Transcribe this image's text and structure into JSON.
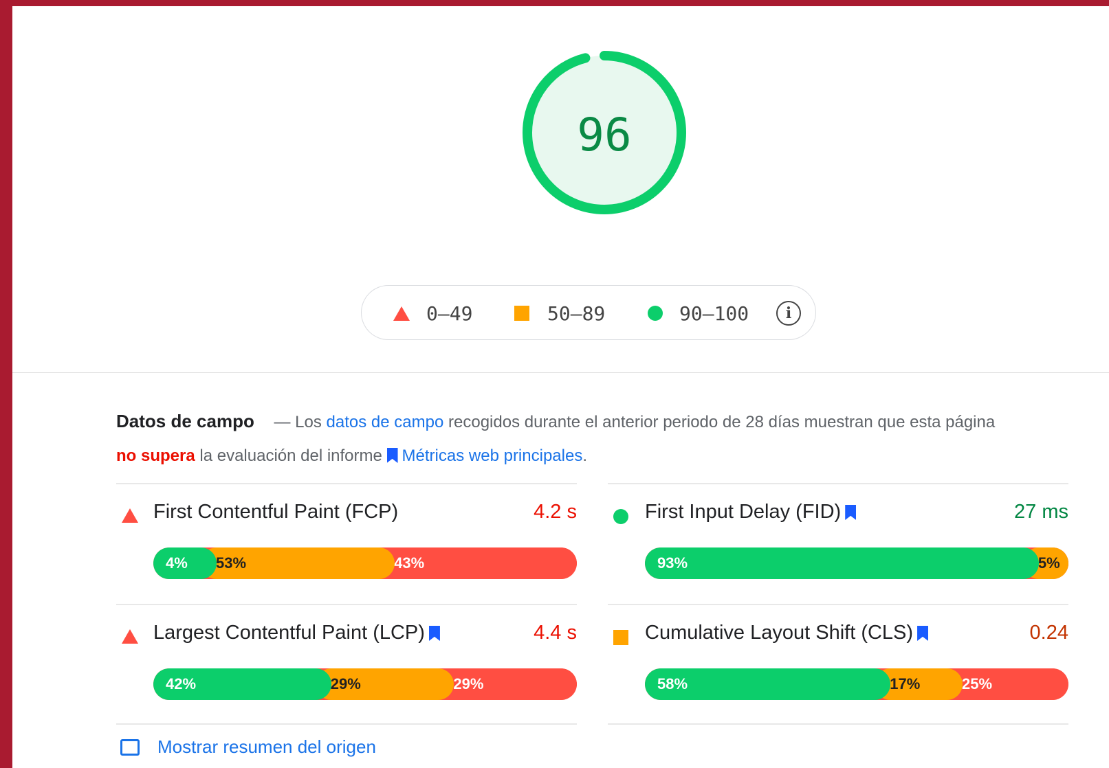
{
  "score": {
    "value": "96",
    "fraction": 0.96,
    "color": "#0cce6b"
  },
  "legend": {
    "fail_range": "0–49",
    "average_range": "50–89",
    "pass_range": "90–100",
    "info_icon": "info-icon"
  },
  "field_data": {
    "title": "Datos de campo",
    "dash": "—",
    "text_before_link": "Los",
    "link_label": "datos de campo",
    "text_after_link": "recogidos durante el anterior periodo de 28 días muestran que esta página",
    "verdict": "no supera",
    "text_after_verdict": "la evaluación del informe",
    "cwv_link": "Métricas web principales",
    "period": "."
  },
  "metrics": [
    {
      "label": "First Contentful Paint (FCP)",
      "value": "4.2 s",
      "status": "fail",
      "core": false,
      "distribution": {
        "good": "4%",
        "average": "53%",
        "poor": "43%"
      },
      "distribution_values": {
        "good": 4,
        "average": 53,
        "poor": 43
      }
    },
    {
      "label": "First Input Delay (FID)",
      "value": "27 ms",
      "status": "pass",
      "core": true,
      "distribution": {
        "good": "93%",
        "average": "5%",
        "poor": "2%"
      },
      "distribution_values": {
        "good": 93,
        "average": 5,
        "poor": 2
      }
    },
    {
      "label": "Largest Contentful Paint (LCP)",
      "value": "4.4 s",
      "status": "fail",
      "core": true,
      "distribution": {
        "good": "42%",
        "average": "29%",
        "poor": "29%"
      },
      "distribution_values": {
        "good": 42,
        "average": 29,
        "poor": 29
      }
    },
    {
      "label": "Cumulative Layout Shift (CLS)",
      "value": "0.24",
      "status": "average",
      "core": true,
      "distribution": {
        "good": "58%",
        "average": "17%",
        "poor": "25%"
      },
      "distribution_values": {
        "good": 58,
        "average": 17,
        "poor": 25
      }
    }
  ],
  "origin_summary_link": "Mostrar resumen del origen",
  "colors": {
    "pass": "#0cce6b",
    "average": "#ffa400",
    "fail": "#ff4e42",
    "link": "#1a73e8",
    "frame": "#a91b30"
  }
}
